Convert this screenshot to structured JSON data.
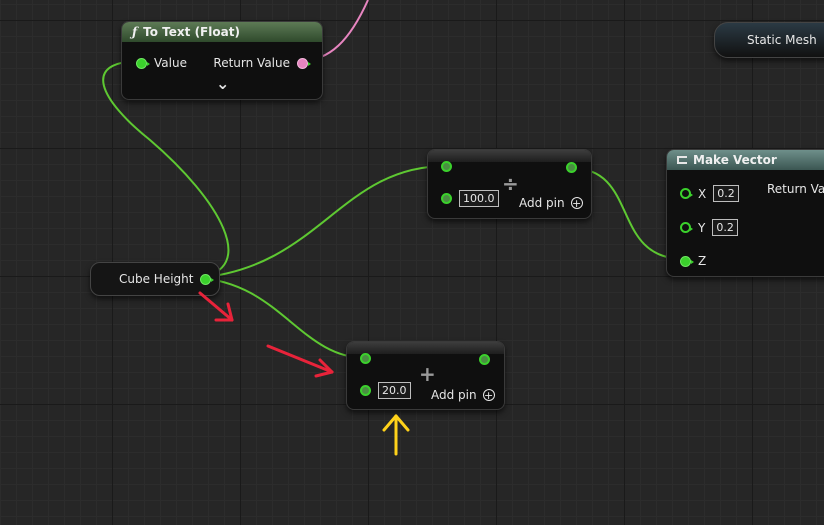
{
  "to_text_node": {
    "title": "To Text (Float)",
    "func_icon": "ƒ",
    "icon": "function-icon",
    "input_label": "Value",
    "output_label": "Return Value",
    "expand_icon": "chevron-down-icon",
    "expand_glyph": "⌄"
  },
  "cube_height_node": {
    "label": "Cube Height"
  },
  "static_mesh_node": {
    "label": "Static Mesh"
  },
  "divide_node": {
    "operator": "÷",
    "b_value": "100.0",
    "add_pin_label": "Add pin",
    "add_pin_glyph": "+"
  },
  "add_node": {
    "operator": "+",
    "b_value": "20.0",
    "add_pin_label": "Add pin",
    "add_pin_glyph": "+"
  },
  "make_vector_node": {
    "title": "Make Vector",
    "icon": "make-struct-icon",
    "x_label": "X",
    "x_value": "0.2",
    "y_label": "Y",
    "y_value": "0.2",
    "z_label": "Z",
    "output_label": "Return Val"
  },
  "colors": {
    "float_wire": "#3bd12c",
    "string_wire": "#e785c0",
    "object_pin": "#22a7f0",
    "red_arrow": "#e8233a",
    "yellow_arrow": "#ffd21a",
    "canvas_bg": "#262626"
  }
}
